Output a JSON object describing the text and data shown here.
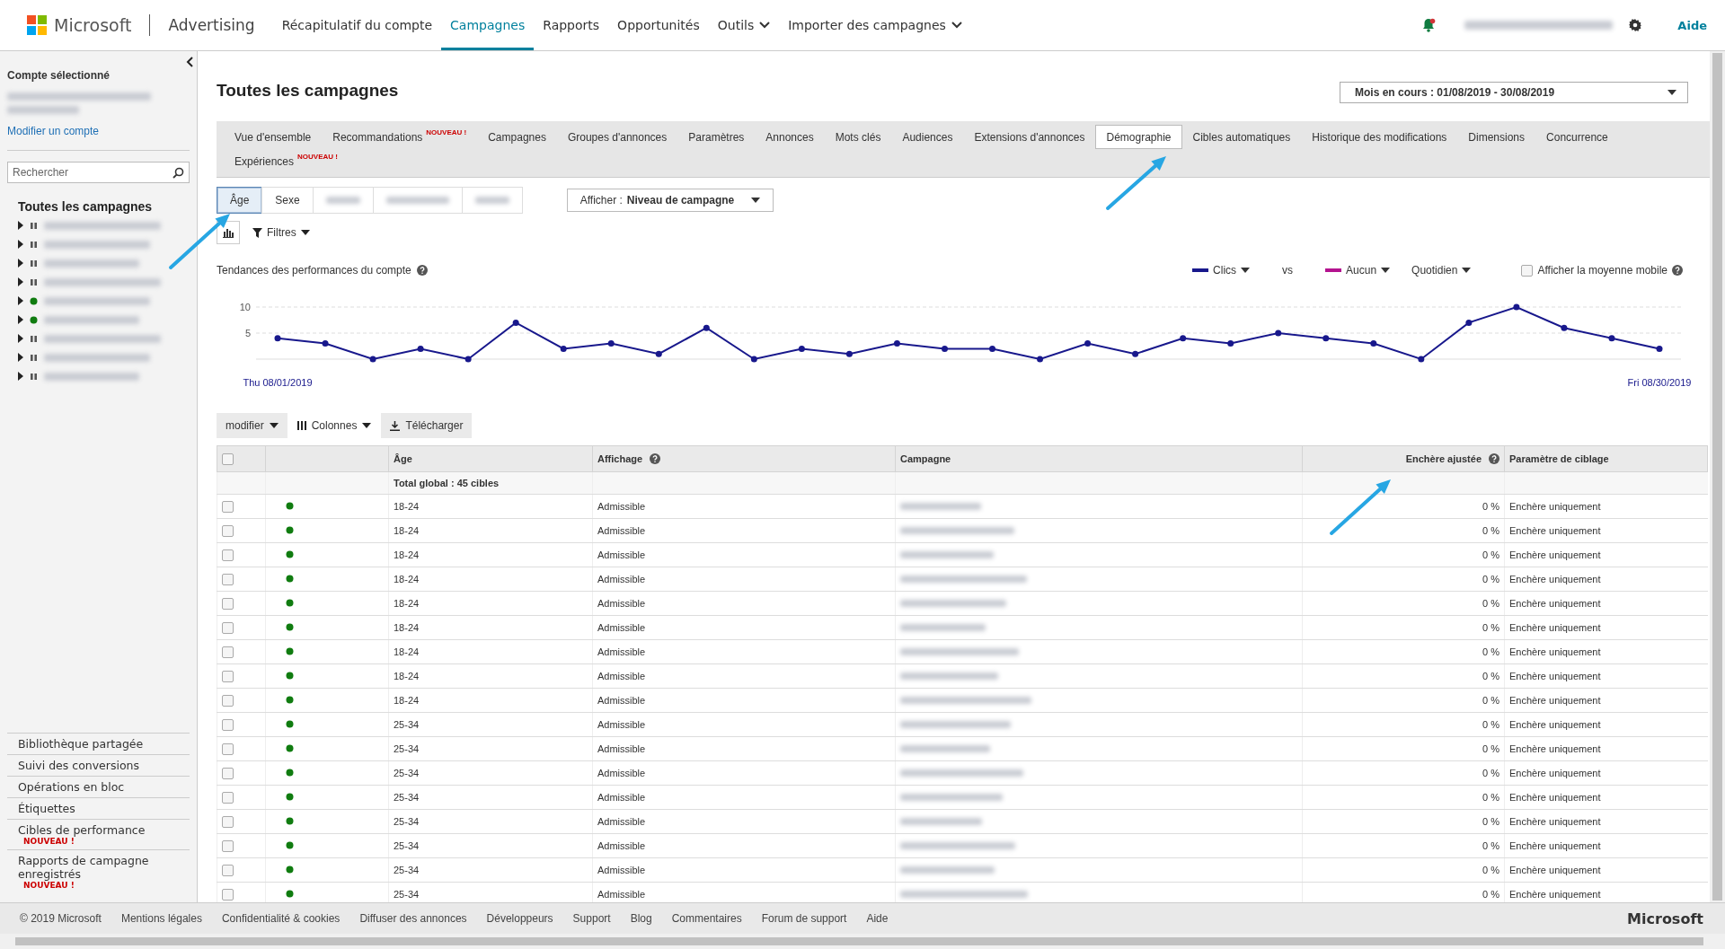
{
  "topbar": {
    "brand": "Microsoft",
    "product": "Advertising",
    "nav": [
      {
        "label": "Récapitulatif du compte",
        "selected": false,
        "dropdown": false
      },
      {
        "label": "Campagnes",
        "selected": true,
        "dropdown": false
      },
      {
        "label": "Rapports",
        "selected": false,
        "dropdown": false
      },
      {
        "label": "Opportunités",
        "selected": false,
        "dropdown": false
      },
      {
        "label": "Outils",
        "selected": false,
        "dropdown": true
      },
      {
        "label": "Importer des campagnes",
        "selected": false,
        "dropdown": true
      }
    ],
    "help": "Aide"
  },
  "sidebar": {
    "account_heading": "Compte sélectionné",
    "change_account": "Modifier un compte",
    "search": {
      "placeholder": "Rechercher"
    },
    "tree_title": "Toutes les campagnes",
    "campaigns": [
      {
        "kind": "paused"
      },
      {
        "kind": "paused"
      },
      {
        "kind": "paused"
      },
      {
        "kind": "paused"
      },
      {
        "kind": "active"
      },
      {
        "kind": "active"
      },
      {
        "kind": "paused"
      },
      {
        "kind": "paused"
      },
      {
        "kind": "paused"
      }
    ],
    "links": [
      {
        "label": "Bibliothèque partagée"
      },
      {
        "label": "Suivi des conversions"
      },
      {
        "label": "Opérations en bloc"
      },
      {
        "label": "Étiquettes"
      },
      {
        "label": "Cibles de performance",
        "badge": "NOUVEAU !"
      },
      {
        "label": "Rapports de campagne enregistrés",
        "badge": "NOUVEAU !"
      }
    ]
  },
  "page": {
    "title": "Toutes les campagnes",
    "date_range": "Mois en cours : 01/08/2019 - 30/08/2019"
  },
  "tabs": [
    {
      "label": "Vue d'ensemble",
      "selected": false
    },
    {
      "label": "Recommandations",
      "badge": "NOUVEAU !",
      "selected": false
    },
    {
      "label": "Campagnes",
      "selected": false
    },
    {
      "label": "Groupes d'annonces",
      "selected": false
    },
    {
      "label": "Paramètres",
      "selected": false
    },
    {
      "label": "Annonces",
      "selected": false
    },
    {
      "label": "Mots clés",
      "selected": false
    },
    {
      "label": "Audiences",
      "selected": false
    },
    {
      "label": "Extensions d'annonces",
      "selected": false
    },
    {
      "label": "Démographie",
      "selected": true
    },
    {
      "label": "Cibles automatiques",
      "selected": false
    },
    {
      "label": "Historique des modifications",
      "selected": false
    },
    {
      "label": "Dimensions",
      "selected": false
    },
    {
      "label": "Concurrence",
      "selected": false
    },
    {
      "label": "Expériences",
      "badge": "NOUVEAU !",
      "selected": false
    }
  ],
  "segments": [
    {
      "kind": "label",
      "label": "Âge",
      "selected": true
    },
    {
      "kind": "label",
      "label": "Sexe",
      "selected": false
    },
    {
      "kind": "redacted",
      "selected": false
    },
    {
      "kind": "redacted",
      "selected": false
    },
    {
      "kind": "redacted",
      "selected": false
    }
  ],
  "view_select": {
    "label": "Afficher :",
    "value": "Niveau de campagne"
  },
  "filters": "Filtres",
  "chart_panel": {
    "title": "Tendances des performances du compte",
    "vs": "vs",
    "compare": {
      "label": "Aucun",
      "color": "#b4138f"
    },
    "period": "Quotidien",
    "moving_average": {
      "label": "Afficher la moyenne mobile",
      "checked": false
    },
    "chart_data": {
      "type": "line",
      "ylim": [
        0,
        10
      ],
      "yticks": [
        5,
        10
      ],
      "categories": [
        "Thu 08/01/2019",
        null,
        null,
        null,
        null,
        null,
        null,
        null,
        null,
        null,
        null,
        null,
        null,
        null,
        null,
        null,
        null,
        null,
        null,
        null,
        null,
        null,
        null,
        null,
        null,
        null,
        null,
        null,
        null,
        "Fri 08/30/2019"
      ],
      "series": [
        {
          "name": "Clics",
          "color": "#18188c",
          "marker": "circle",
          "values": [
            4,
            3,
            0,
            2,
            0,
            7,
            2,
            3,
            1,
            6,
            0,
            2,
            1,
            3,
            2,
            2,
            0,
            3,
            1,
            4,
            3,
            5,
            4,
            3,
            0,
            7,
            10,
            6,
            4,
            2
          ]
        }
      ]
    }
  },
  "table_toolbar": {
    "edit": "modifier",
    "columns": "Colonnes",
    "download": "Télécharger"
  },
  "table": {
    "select_all": {
      "checked": false
    },
    "columns": [
      {
        "label": "Âge",
        "help": false
      },
      {
        "label": "Affichage",
        "help": true
      },
      {
        "label": "Campagne",
        "help": false
      },
      {
        "label": "Enchère ajustée",
        "help": true
      },
      {
        "label": "Paramètre de ciblage",
        "help": false
      }
    ],
    "total": "Total global : 45 cibles",
    "rows": [
      {
        "checked": false,
        "kind": "active",
        "age": "18-24",
        "display": "Admissible",
        "bid": "0 %",
        "targeting": "Enchère uniquement"
      },
      {
        "checked": false,
        "kind": "active",
        "age": "18-24",
        "display": "Admissible",
        "bid": "0 %",
        "targeting": "Enchère uniquement"
      },
      {
        "checked": false,
        "kind": "active",
        "age": "18-24",
        "display": "Admissible",
        "bid": "0 %",
        "targeting": "Enchère uniquement"
      },
      {
        "checked": false,
        "kind": "active",
        "age": "18-24",
        "display": "Admissible",
        "bid": "0 %",
        "targeting": "Enchère uniquement"
      },
      {
        "checked": false,
        "kind": "active",
        "age": "18-24",
        "display": "Admissible",
        "bid": "0 %",
        "targeting": "Enchère uniquement"
      },
      {
        "checked": false,
        "kind": "active",
        "age": "18-24",
        "display": "Admissible",
        "bid": "0 %",
        "targeting": "Enchère uniquement"
      },
      {
        "checked": false,
        "kind": "active",
        "age": "18-24",
        "display": "Admissible",
        "bid": "0 %",
        "targeting": "Enchère uniquement"
      },
      {
        "checked": false,
        "kind": "active",
        "age": "18-24",
        "display": "Admissible",
        "bid": "0 %",
        "targeting": "Enchère uniquement"
      },
      {
        "checked": false,
        "kind": "active",
        "age": "18-24",
        "display": "Admissible",
        "bid": "0 %",
        "targeting": "Enchère uniquement"
      },
      {
        "checked": false,
        "kind": "active",
        "age": "25-34",
        "display": "Admissible",
        "bid": "0 %",
        "targeting": "Enchère uniquement"
      },
      {
        "checked": false,
        "kind": "active",
        "age": "25-34",
        "display": "Admissible",
        "bid": "0 %",
        "targeting": "Enchère uniquement"
      },
      {
        "checked": false,
        "kind": "active",
        "age": "25-34",
        "display": "Admissible",
        "bid": "0 %",
        "targeting": "Enchère uniquement"
      },
      {
        "checked": false,
        "kind": "active",
        "age": "25-34",
        "display": "Admissible",
        "bid": "0 %",
        "targeting": "Enchère uniquement"
      },
      {
        "checked": false,
        "kind": "active",
        "age": "25-34",
        "display": "Admissible",
        "bid": "0 %",
        "targeting": "Enchère uniquement"
      },
      {
        "checked": false,
        "kind": "active",
        "age": "25-34",
        "display": "Admissible",
        "bid": "0 %",
        "targeting": "Enchère uniquement"
      },
      {
        "checked": false,
        "kind": "active",
        "age": "25-34",
        "display": "Admissible",
        "bid": "0 %",
        "targeting": "Enchère uniquement"
      },
      {
        "checked": false,
        "kind": "active",
        "age": "25-34",
        "display": "Admissible",
        "bid": "0 %",
        "targeting": "Enchère uniquement"
      }
    ]
  },
  "footer": {
    "links": [
      "© 2019 Microsoft",
      "Mentions légales",
      "Confidentialité & cookies",
      "Diffuser des annonces",
      "Développeurs",
      "Support",
      "Blog",
      "Commentaires",
      "Forum de support",
      "Aide"
    ],
    "brand": "Microsoft"
  }
}
